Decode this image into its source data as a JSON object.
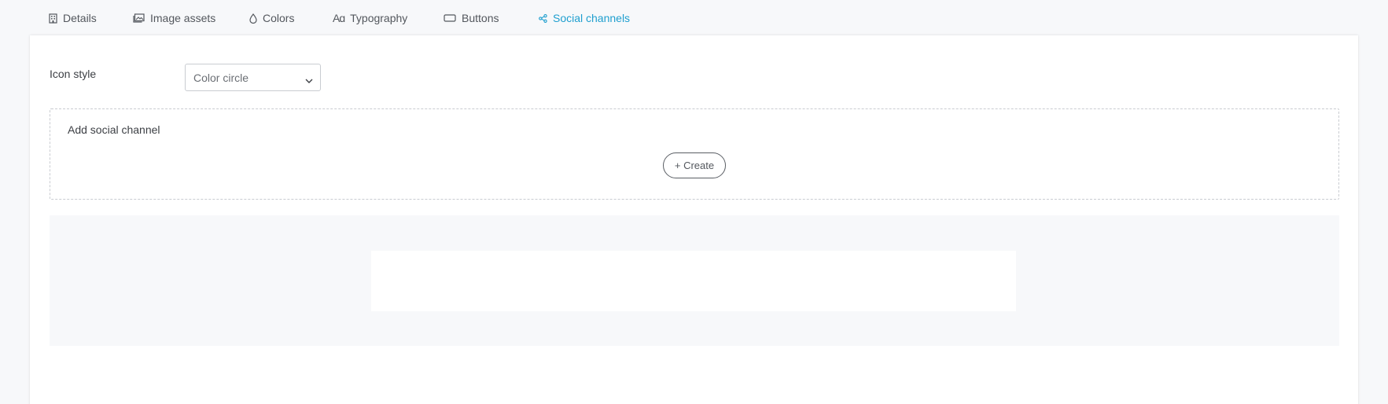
{
  "tabs": [
    {
      "label": "Details",
      "icon": "building-icon",
      "active": false
    },
    {
      "label": "Image assets",
      "icon": "image-icon",
      "active": false
    },
    {
      "label": "Colors",
      "icon": "droplet-icon",
      "active": false
    },
    {
      "label": "Typography",
      "icon": "typography-icon",
      "active": false
    },
    {
      "label": "Buttons",
      "icon": "button-icon",
      "active": false
    },
    {
      "label": "Social channels",
      "icon": "share-icon",
      "active": true
    }
  ],
  "icon_style": {
    "label": "Icon style",
    "selected": "Color circle"
  },
  "add_social_channel": {
    "title": "Add social channel",
    "create_label": "+ Create"
  },
  "colors": {
    "accent": "#1f9fcf",
    "background": "#f7f8fa",
    "panel": "#ffffff",
    "text": "#3c3f44"
  }
}
